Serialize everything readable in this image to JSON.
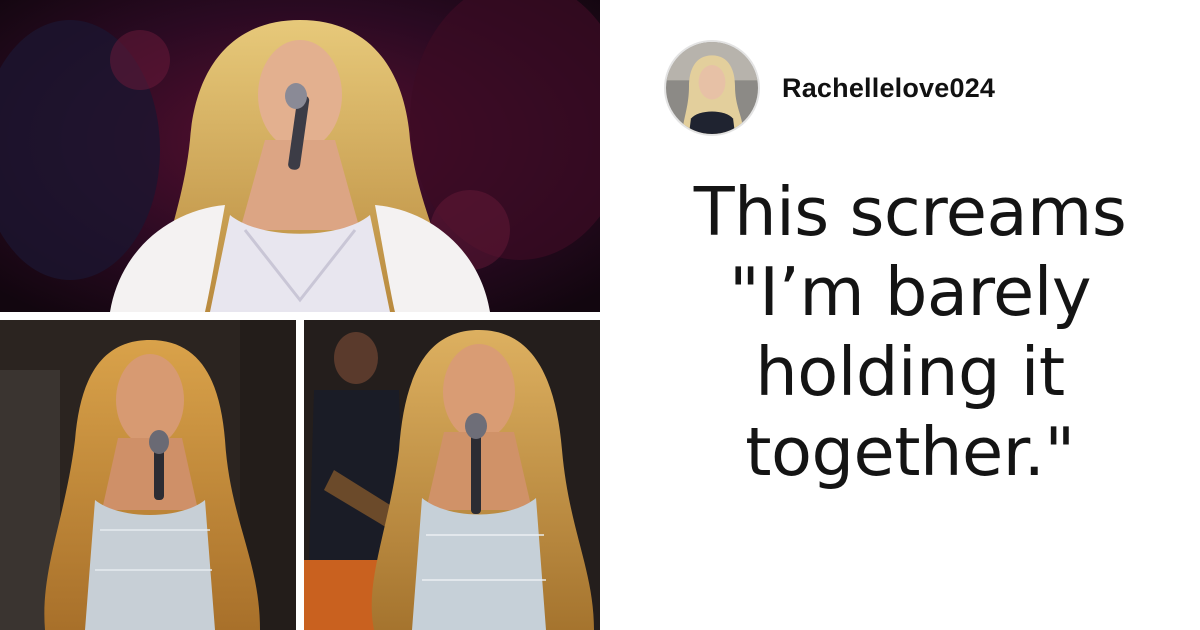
{
  "images": [
    {
      "name": "performer-on-stage"
    },
    {
      "name": "performer-closeup-left"
    },
    {
      "name": "performer-closeup-right"
    }
  ],
  "comment": {
    "username": "Rachellelove024",
    "lines": [
      "This screams",
      "\"I’m barely",
      "holding it",
      "together.\""
    ]
  },
  "colors": {
    "text": "#141414",
    "background": "#ffffff"
  }
}
